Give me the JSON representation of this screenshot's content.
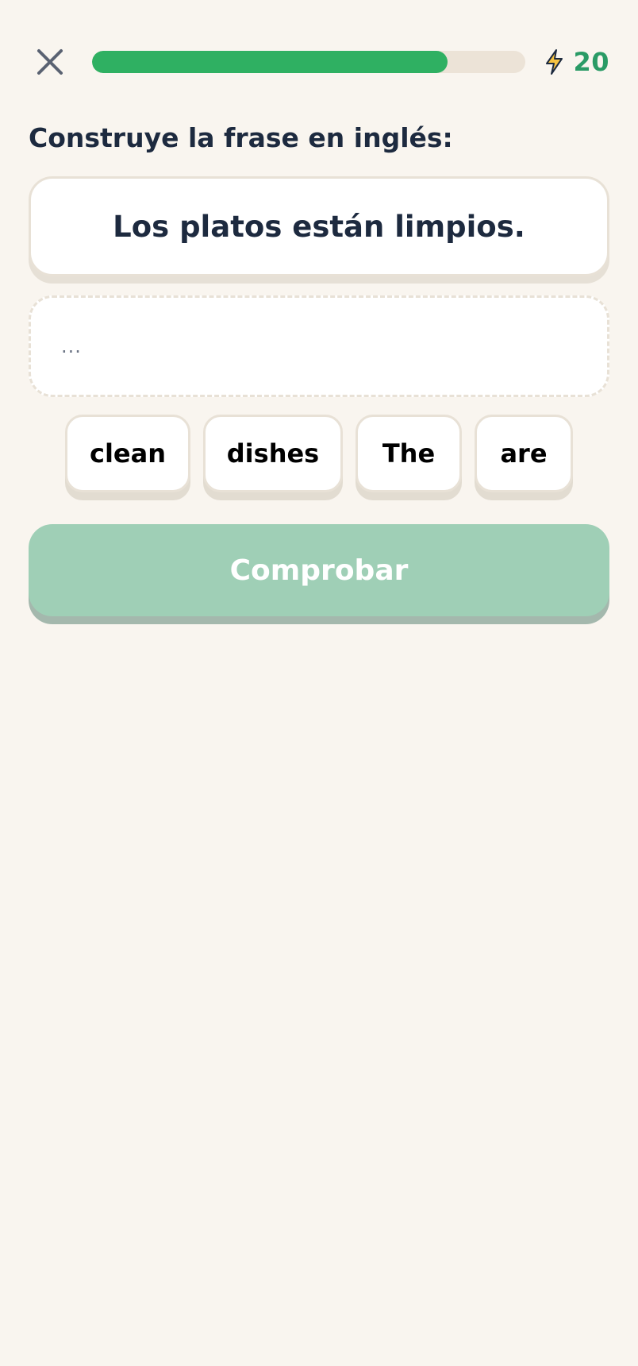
{
  "header": {
    "close_icon": "close-icon",
    "progress_fraction": 0.82,
    "energy_icon": "lightning-bolt-icon",
    "energy_count": "20"
  },
  "exercise": {
    "prompt": "Construye la frase en inglés:",
    "source_sentence": "Los platos están limpios.",
    "answer_placeholder": "...",
    "word_bank": [
      "clean",
      "dishes",
      "The",
      "are"
    ]
  },
  "actions": {
    "check_label": "Comprobar"
  },
  "colors": {
    "background": "#f9f5ef",
    "progress_fill": "#2fb062",
    "progress_track": "#ece3d7",
    "energy_text": "#2a9b66",
    "check_button_disabled": "#9fcfb6",
    "text_dark": "#1d2a3f"
  }
}
